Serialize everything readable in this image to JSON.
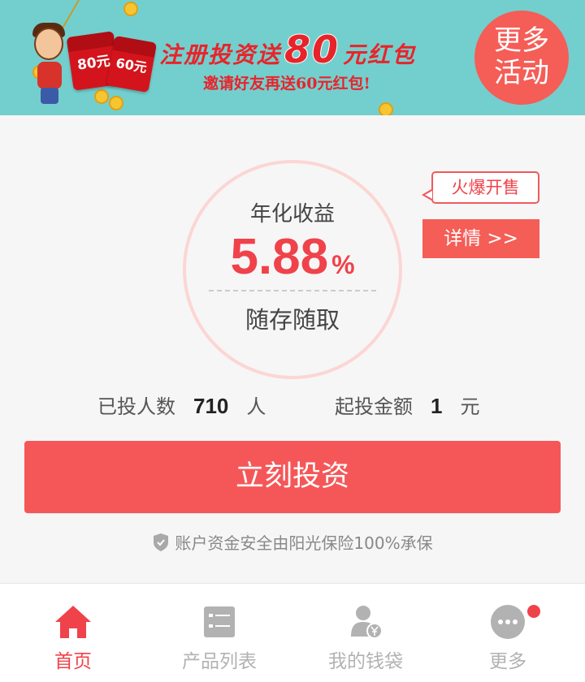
{
  "banner": {
    "title_pre": "注册投资送",
    "title_amount": "80",
    "title_post": "元红包",
    "subtitle": "邀请好友再送60元红包!",
    "envelope_1": "80元",
    "envelope_2": "60元",
    "more_activities": "更多\n活动"
  },
  "product": {
    "rate_label": "年化收益",
    "rate_value": "5.88",
    "rate_unit": "%",
    "mode": "随存随取",
    "hot_tag": "火爆开售",
    "details_button": "详情 >>"
  },
  "stats": {
    "investors_label": "已投人数",
    "investors_value": "710",
    "investors_unit": "人",
    "minimum_label": "起投金额",
    "minimum_value": "1",
    "minimum_unit": "元"
  },
  "actions": {
    "invest_button": "立刻投资"
  },
  "security_note": "账户资金安全由阳光保险100%承保",
  "bottom_nav": [
    {
      "label": "首页",
      "icon": "home-icon",
      "active": true
    },
    {
      "label": "产品列表",
      "icon": "list-icon",
      "active": false
    },
    {
      "label": "我的钱袋",
      "icon": "wallet-user-icon",
      "active": false
    },
    {
      "label": "更多",
      "icon": "more-icon",
      "active": false,
      "badge": true
    }
  ],
  "colors": {
    "brand_red": "#f55758",
    "banner_bg": "#73cfcd",
    "circle_ring": "#fcd6d4",
    "inactive_gray": "#b2b2b2"
  }
}
